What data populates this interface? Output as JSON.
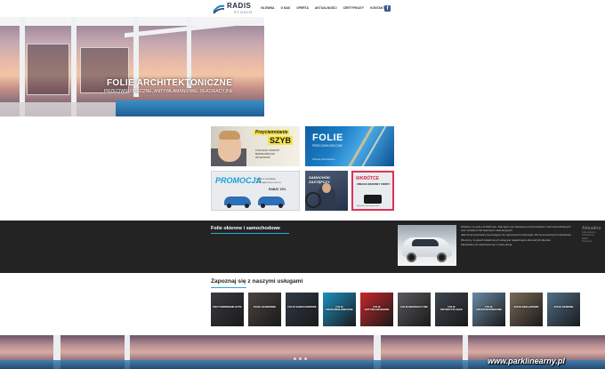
{
  "header": {
    "logo_text": "RADIS",
    "logo_sub": "STUDIO",
    "nav": [
      "Główna",
      "O nas",
      "Oferta",
      "Aktualności",
      "Certyfikaty",
      "Kontakt"
    ],
    "facebook_glyph": "f"
  },
  "hero": {
    "title": "FOLIE ARCHITEKTONICZNE",
    "subtitle": "PRZECIWSŁONECZNE, ANTYWŁAMANIOWE, DEKORACYJNE"
  },
  "tiles": {
    "t1": {
      "title": "Przyciemnianie",
      "big": "SZYB",
      "lines": [
        "ZYSKUJESZ: KOMFORT",
        "BEZPIECZEŃSTWO",
        "PRYWATNOŚĆ"
      ]
    },
    "t2": {
      "big": "FOLIE",
      "sub": "PRZECIWSŁONECZNE",
      "line": "Ochrona przed słońcem"
    },
    "t3": {
      "big": "PROMOCJA",
      "lines": [
        "NA PRZYCIEMNIANIE",
        "SZYB SAMOCHODOWYCH"
      ],
      "rabat": "RABAT 15%"
    },
    "t4": {
      "big": "SAMOCHÓD ZASTĘPCZY"
    },
    "t5": {
      "big": "WKRÓTCE",
      "sub": "ZMIANA SIEDZIBY FIRMY!",
      "line": "Sprawdź nasz nowy adres"
    }
  },
  "band": {
    "title": "Folie okienne i samochodowe",
    "paragraphs": [
      "Działamy na rynku od 2003 roku. Zajmujemy się zawodowo przyciemnianiem szyb samochodowych oraz montażem folii okiennych i dekoracyjnych.",
      "Jako firma wyróżniamy się dostępem do najnowszych technologii i folii renomowanych producentów.",
      "Wierzymy, że jakość świadczonych usług jest najważniejsza dla naszych klientów.",
      "Zapraszamy do zapoznania się z naszą ofertą."
    ],
    "side_title": "Aktualno",
    "side_lines": [
      "Folie okienne",
      "Przyciemnia",
      "Rabat",
      "Promocja"
    ]
  },
  "services": {
    "title": "Zapoznaj się z naszymi usługami",
    "items": [
      {
        "label": "Przyciemnianie szyb",
        "color": "#3b3b40"
      },
      {
        "label": "Folie ochronne",
        "color": "#4a4440"
      },
      {
        "label": "Folie samochodowe",
        "color": "#2f3a48"
      },
      {
        "label": "Folie przeciwsłoneczne",
        "color": "#1d8fc0"
      },
      {
        "label": "Folie antywłamaniowe",
        "color": "#c8262a"
      },
      {
        "label": "Folie dekoracyjne",
        "color": "#5a5a5e"
      },
      {
        "label": "Folie prywatyzujące",
        "color": "#3e4650"
      },
      {
        "label": "Folie architektoniczne",
        "color": "#6a8aa6"
      },
      {
        "label": "Folie reklamowe",
        "color": "#7a6a5a"
      },
      {
        "label": "Folie okienne",
        "color": "#4f6f8a"
      }
    ]
  },
  "watermark": "www.parklinearny.pl",
  "colors": {
    "accent": "#29a8e0",
    "band": "#232323",
    "facebook": "#3b5998"
  }
}
